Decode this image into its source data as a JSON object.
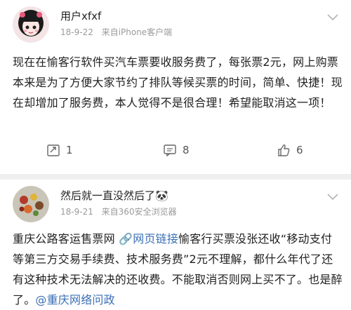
{
  "posts": [
    {
      "username": "用户xfxf",
      "date": "18-9-22",
      "source": "来自iPhone客户端",
      "content": "现在在愉客行软件买汽车票要收服务费了，每张票2元，网上购票本来是为了方便大家节约了排队等候买票的时间，简单、快捷！现在却增加了服务费，本人觉得不是很合理！希望能取消这一项！",
      "actions": {
        "repost_count": "1",
        "comment_count": "8",
        "like_count": "6"
      }
    },
    {
      "username": "然后就一直没然后了🐼",
      "date": "18-9-21",
      "source": "来自360安全浏览器",
      "content_part1": "重庆公路客运售票网 ",
      "link_text": "🔗网页链接",
      "content_part2": "愉客行买票没张还收“移动支付等第三方交易手续费、技术服务费”2元不理解，都什么年代了还有这种技术无法解决的还收费。不能取消否则网上买不了。也是醉了。",
      "mention": "@重庆网络问政"
    }
  ]
}
